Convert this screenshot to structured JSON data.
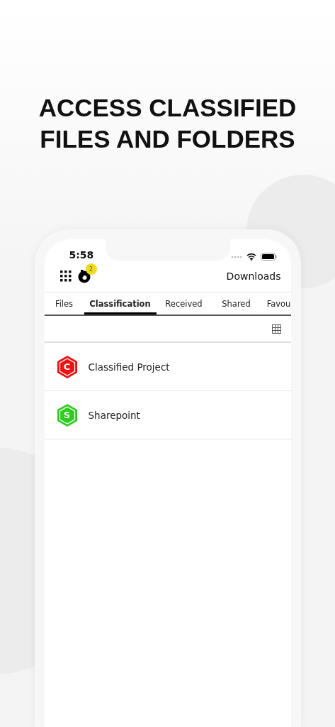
{
  "headline": [
    "ACCESS CLASSIFIED",
    "FILES AND FOLDERS"
  ],
  "status_bar": {
    "time": "5:58"
  },
  "header": {
    "badge": "2",
    "title": "Downloads"
  },
  "tabs": [
    {
      "label": "Files",
      "selected": false
    },
    {
      "label": "Classification",
      "selected": true
    },
    {
      "label": "Received",
      "selected": false
    },
    {
      "label": "Shared",
      "selected": false
    },
    {
      "label": "Favou",
      "selected": false
    }
  ],
  "items": [
    {
      "letter": "C",
      "name": "Classified Project",
      "color": "#ee1111"
    },
    {
      "letter": "S",
      "name": "Sharepoint",
      "color": "#2ecc1f"
    }
  ]
}
